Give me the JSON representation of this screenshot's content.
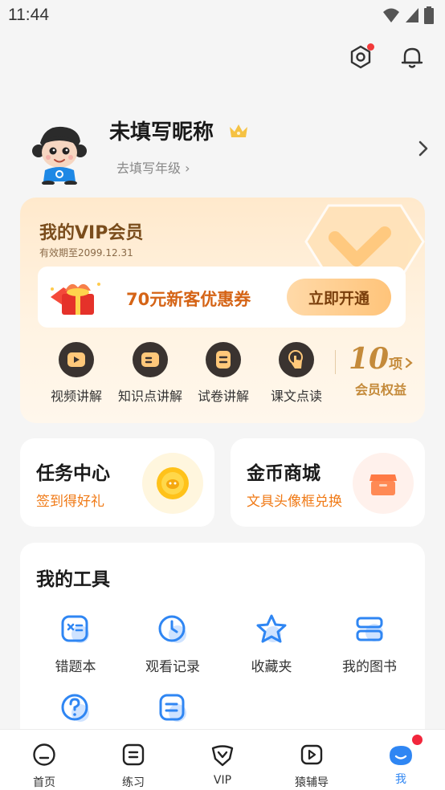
{
  "status": {
    "time": "11:44"
  },
  "profile": {
    "nickname": "未填写昵称",
    "grade_link": "去填写年级 ›"
  },
  "vip": {
    "title": "我的VIP会员",
    "validity": "有效期至2099.12.31",
    "coupon_text": "70元新客优惠券",
    "coupon_button": "立即开通",
    "perks": [
      "视频讲解",
      "知识点讲解",
      "试卷讲解",
      "课文点读"
    ],
    "perk_count": "10",
    "perk_count_unit": "项",
    "perk_count_label": "会员权益"
  },
  "task_center": {
    "title": "任务中心",
    "subtitle": "签到得好礼"
  },
  "coin_mall": {
    "title": "金币商城",
    "subtitle": "文具头像框兑换"
  },
  "tools": {
    "title": "我的工具",
    "items": [
      "错题本",
      "观看记录",
      "收藏夹",
      "我的图书"
    ]
  },
  "nav": {
    "items": [
      "首页",
      "练习",
      "VIP",
      "猿辅导",
      "我"
    ],
    "active": "我"
  },
  "colors": {
    "accent": "#2f86f3",
    "orange": "#f07a16",
    "vip_gold": "#c48a3a"
  }
}
